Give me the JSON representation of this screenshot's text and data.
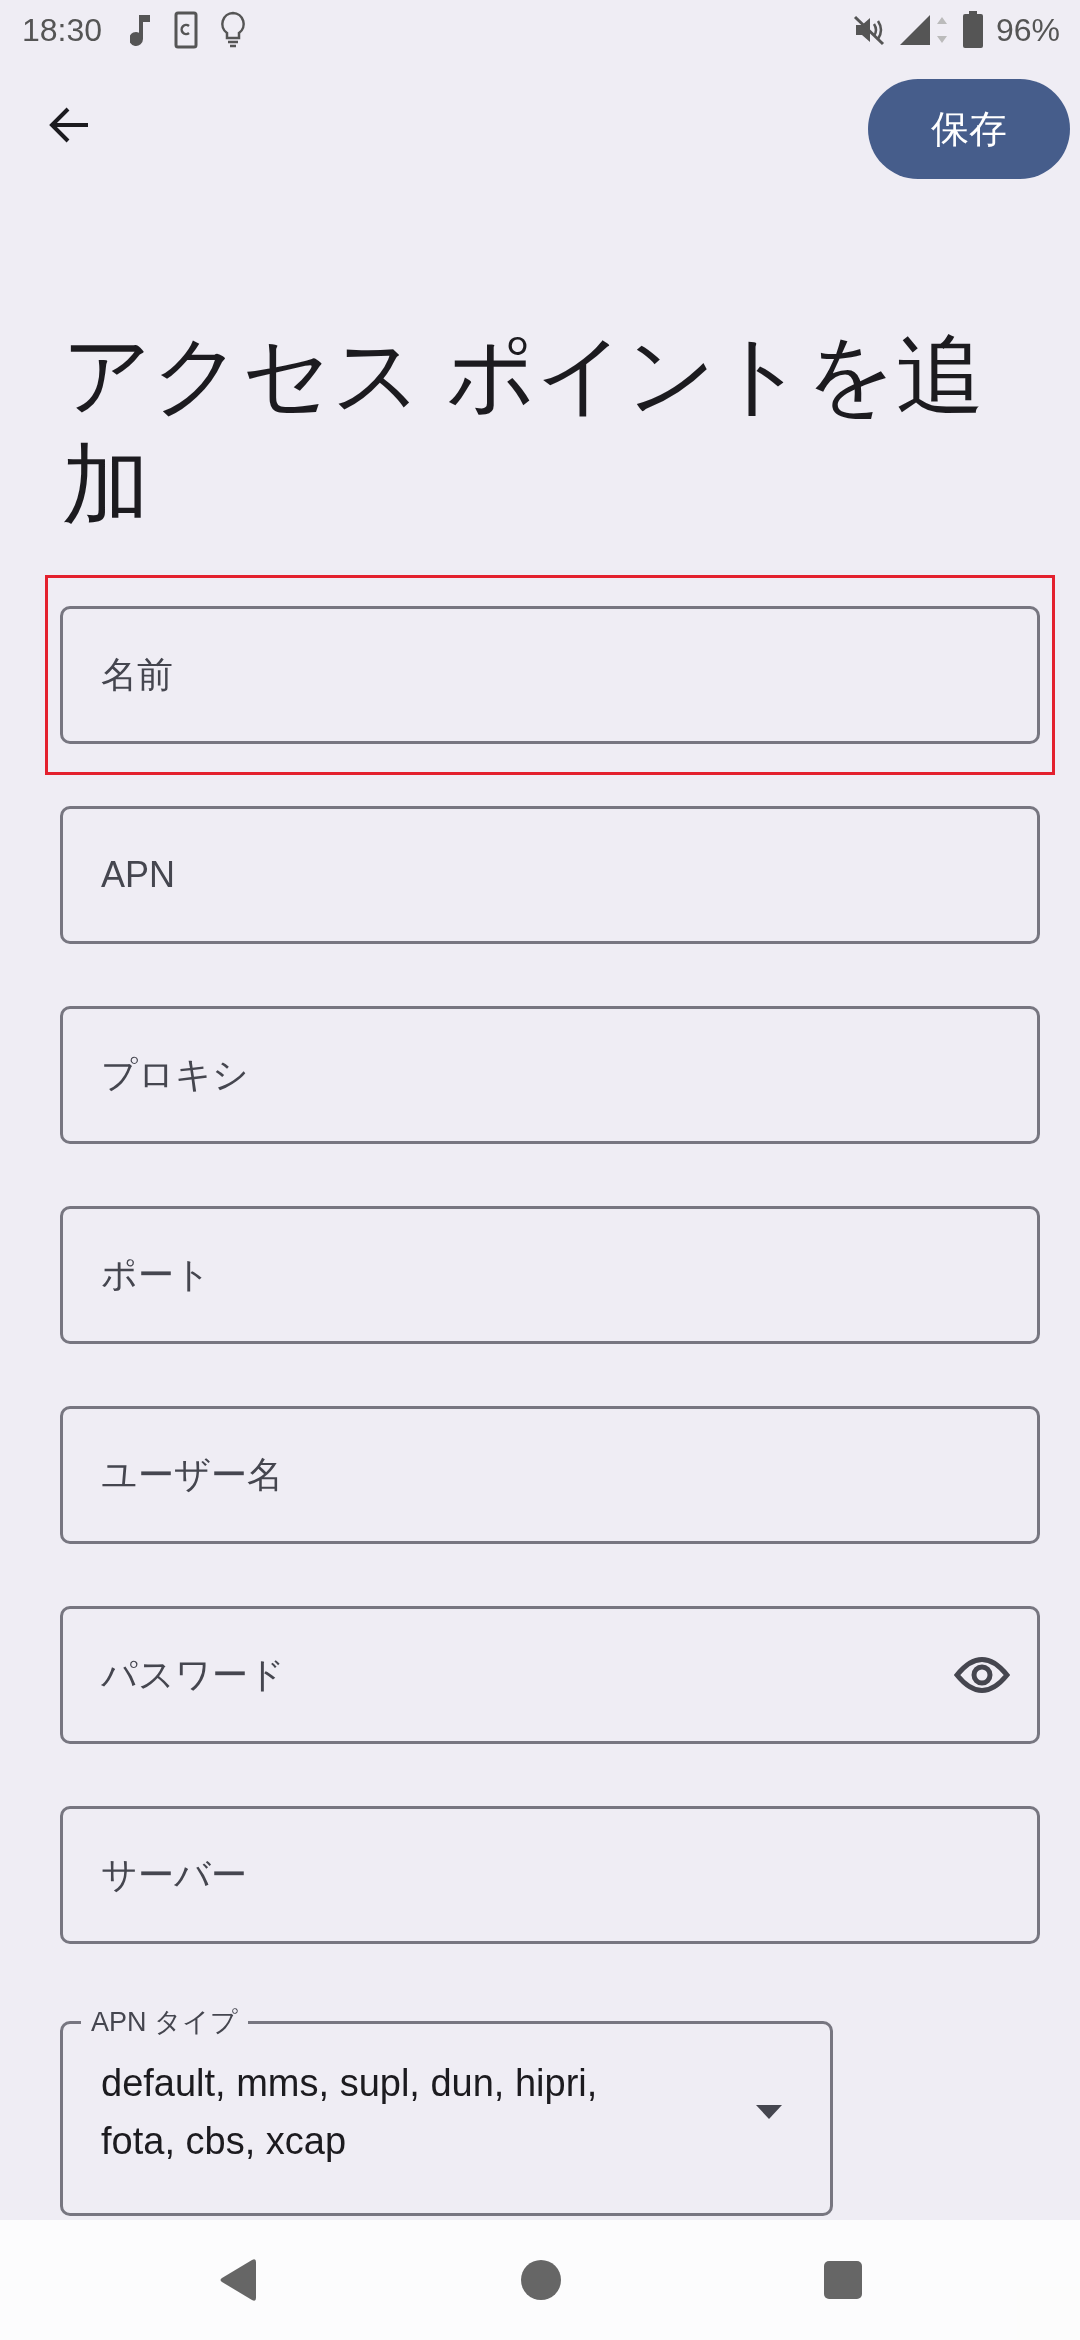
{
  "status_bar": {
    "time": "18:30",
    "battery": "96%"
  },
  "toolbar": {
    "save_button": "保存"
  },
  "title": "アクセス ポイントを追加",
  "fields": [
    {
      "kind": "text",
      "placeholder": "名前",
      "highlighted": true
    },
    {
      "kind": "text",
      "placeholder": "APN",
      "highlighted": false
    },
    {
      "kind": "text",
      "placeholder": "プロキシ",
      "highlighted": false
    },
    {
      "kind": "text",
      "placeholder": "ポート",
      "highlighted": false
    },
    {
      "kind": "text",
      "placeholder": "ユーザー名",
      "highlighted": false
    },
    {
      "kind": "password",
      "placeholder": "パスワード",
      "highlighted": false
    },
    {
      "kind": "text",
      "placeholder": "サーバー",
      "highlighted": false
    },
    {
      "kind": "dropdown",
      "label": "APN タイプ",
      "value": "default, mms, supl, dun, hipri, fota, cbs, xcap",
      "highlighted": false
    }
  ]
}
